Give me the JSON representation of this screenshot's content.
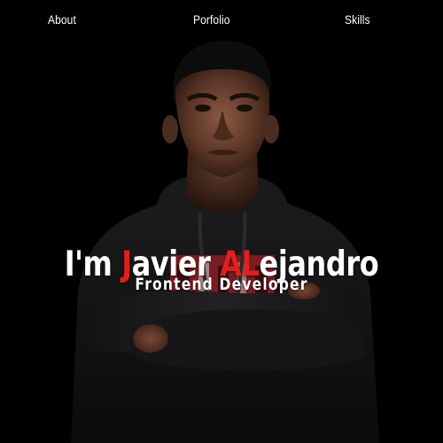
{
  "nav": {
    "about": "About",
    "portfolio": "Porfolio",
    "skills": "Skills"
  },
  "hero": {
    "greeting": "I'm ",
    "name_initial_1": "J",
    "name_rest_1": "avier ",
    "name_initial_2": "AL",
    "name_rest_2": "ejandro",
    "subtitle": "Frontend Developer"
  },
  "colors": {
    "background": "#000000",
    "text": "#ffffff",
    "accent": "#e0201e"
  },
  "icons": {
    "portrait": "profile-photo"
  }
}
